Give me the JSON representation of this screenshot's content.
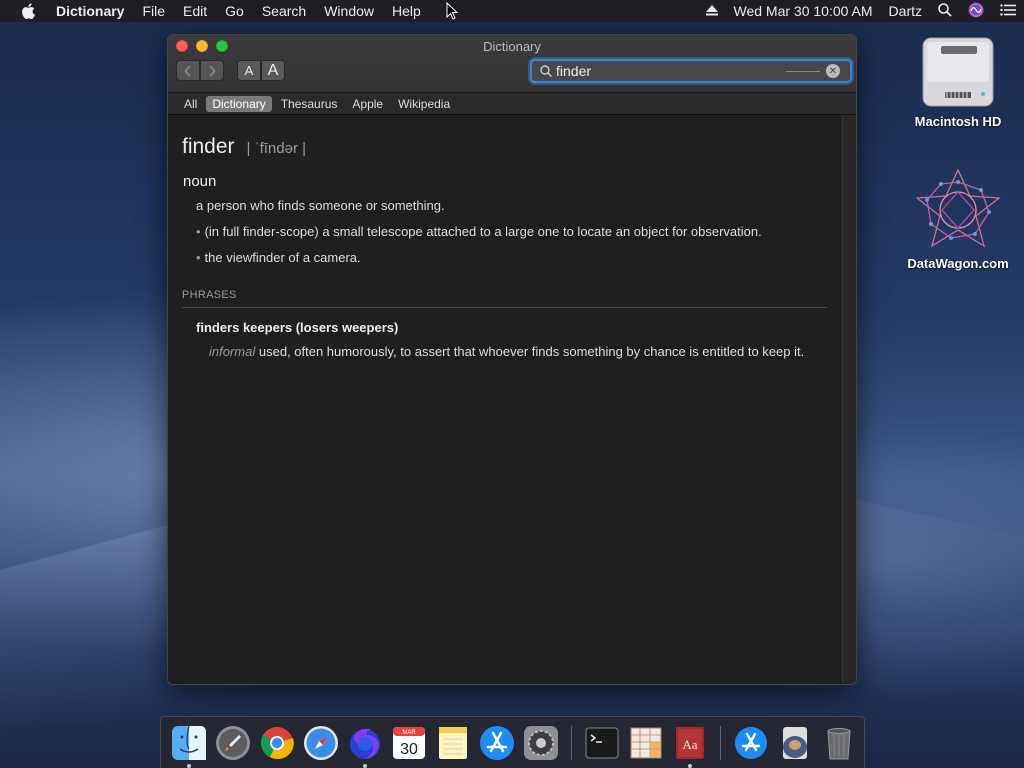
{
  "menubar": {
    "app": "Dictionary",
    "items": [
      "File",
      "Edit",
      "Go",
      "Search",
      "Window",
      "Help"
    ],
    "clock": "Wed Mar 30  10:00 AM",
    "user": "Dartz"
  },
  "desktop": {
    "icons": [
      {
        "label": "Macintosh HD"
      },
      {
        "label": "DataWagon.com"
      }
    ]
  },
  "window": {
    "title": "Dictionary",
    "font_small": "A",
    "font_large": "A",
    "search": {
      "value": "finder"
    },
    "sources": [
      "All",
      "Dictionary",
      "Thesaurus",
      "Apple",
      "Wikipedia"
    ],
    "active_source": "Dictionary"
  },
  "entry": {
    "headword": "finder",
    "pronunciation": "| ˈfīndər |",
    "part_of_speech": "noun",
    "definitions": [
      "a person who finds someone or something.",
      "(in full finder-scope) a small telescope attached to a large one to locate an object for observation.",
      "the viewfinder of a camera."
    ],
    "phrases_heading": "PHRASES",
    "phrase": "finders keepers (losers weepers)",
    "phrase_register": "informal",
    "phrase_definition": " used, often humorously, to assert that whoever finds something by chance is entitled to keep it."
  },
  "dock": {
    "calendar_month": "MAR",
    "calendar_day": "30",
    "dictionary_glyph": "Aa"
  },
  "colors": {
    "accent": "#3f84d6",
    "close": "#fe5f57",
    "minimize": "#febc2e",
    "maximize": "#28c840"
  }
}
